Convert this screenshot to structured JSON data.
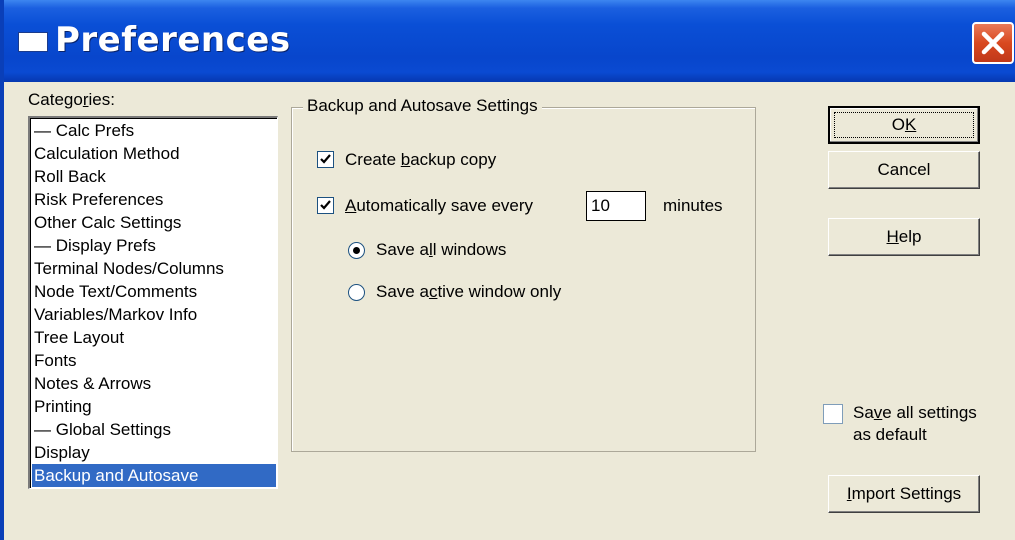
{
  "window": {
    "title": "Preferences"
  },
  "categories": {
    "label": "Categories:",
    "items": [
      "— Calc Prefs",
      "Calculation Method",
      "Roll Back",
      "Risk Preferences",
      "Other Calc Settings",
      "— Display Prefs",
      "Terminal Nodes/Columns",
      "Node Text/Comments",
      "Variables/Markov Info",
      "Tree Layout",
      "Fonts",
      "Notes & Arrows",
      "Printing",
      "— Global Settings",
      "Display",
      "Backup and Autosave"
    ],
    "selected": "Backup and Autosave"
  },
  "settings": {
    "group_title": "Backup and Autosave Settings",
    "create_backup": {
      "label": "Create backup copy",
      "checked": true
    },
    "autosave": {
      "label": "Automatically save every",
      "checked": true,
      "value": "10",
      "unit": "minutes"
    },
    "save_all_windows": {
      "label": "Save all windows",
      "selected": true
    },
    "save_active_window": {
      "label": "Save active window only",
      "selected": false
    }
  },
  "buttons": {
    "ok": "OK",
    "cancel": "Cancel",
    "help": "Help",
    "import": "Import Settings"
  },
  "save_default": {
    "label_line1": "Save all settings",
    "label_line2": "as default",
    "checked": false
  }
}
